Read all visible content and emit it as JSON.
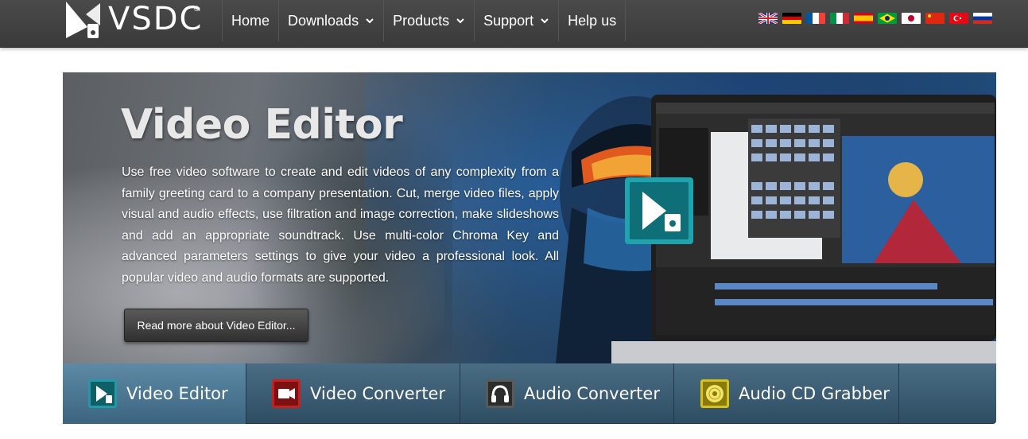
{
  "header": {
    "logo_text": "VSDC",
    "logo_reg": "®",
    "nav": [
      {
        "label": "Home",
        "has_menu": false
      },
      {
        "label": "Downloads",
        "has_menu": true
      },
      {
        "label": "Products",
        "has_menu": true
      },
      {
        "label": "Support",
        "has_menu": true
      },
      {
        "label": "Help us",
        "has_menu": false
      }
    ],
    "flags": [
      "uk-flag",
      "german-flag",
      "french-flag",
      "italian-flag",
      "spanish-flag",
      "brazil-flag",
      "japan-flag",
      "china-flag",
      "turkey-flag",
      "russia-flag"
    ]
  },
  "hero": {
    "title": "Video Editor",
    "description": "Use free video software to create and edit videos of any complexity from a family greeting card to a company presentation. Cut, merge video files, apply visual and audio effects, use filtration and image correction, make slideshows and add an appropriate soundtrack. Use multi-color Chroma Key and advanced parameters settings to give your video a professional look. All popular video and audio formats are supported.",
    "button_label": "Read more about Video Editor..."
  },
  "tabs": [
    {
      "label": "Video Editor",
      "icon": "video-editor-icon",
      "active": true,
      "color": "#1f9aa6"
    },
    {
      "label": "Video Converter",
      "icon": "video-converter-icon",
      "active": false,
      "color": "#c8201f"
    },
    {
      "label": "Audio Converter",
      "icon": "audio-converter-icon",
      "active": false,
      "color": "#555555"
    },
    {
      "label": "Audio CD Grabber",
      "icon": "audio-cd-grabber-icon",
      "active": false,
      "color": "#d8c21a"
    }
  ],
  "colors": {
    "topbar": "#3f3f3f",
    "tabs_bg": "#3a5d75",
    "tab_active": "#4e7a96",
    "accent_teal": "#1fa3ad"
  }
}
